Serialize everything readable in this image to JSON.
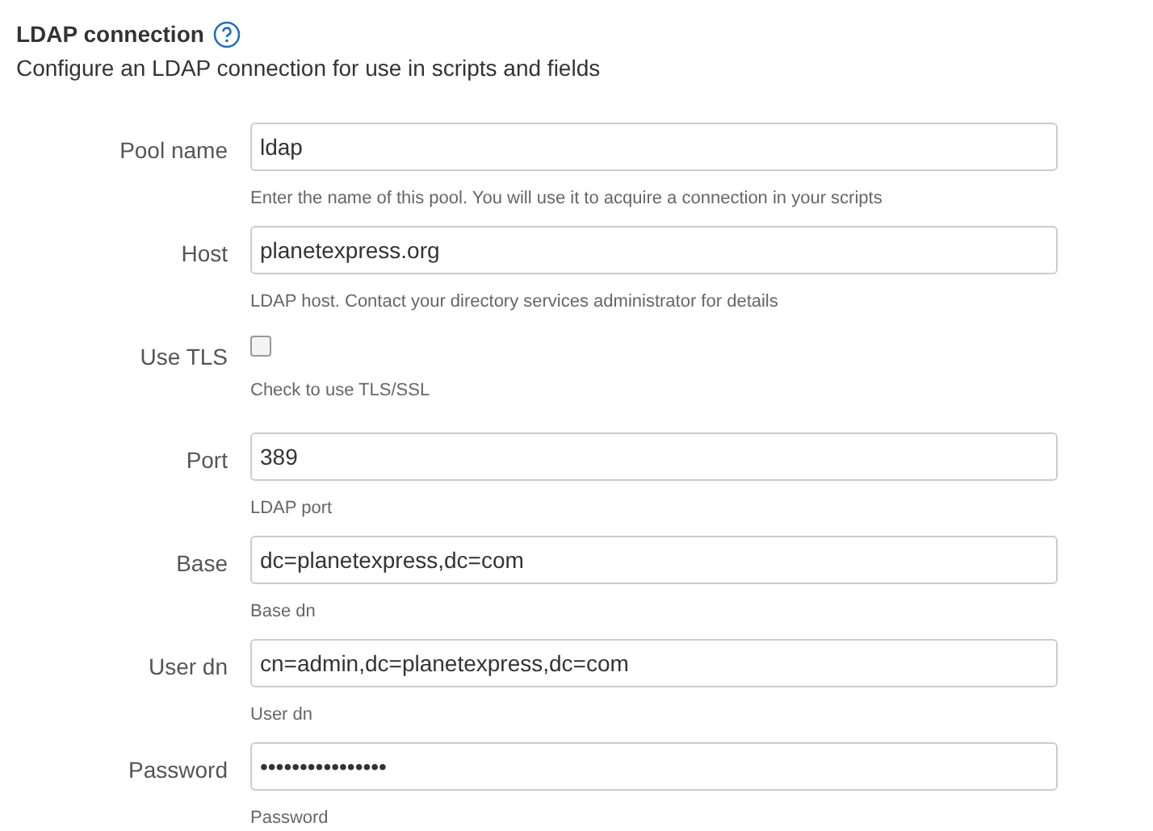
{
  "header": {
    "title": "LDAP connection",
    "subtitle": "Configure an LDAP connection for use in scripts and fields"
  },
  "fields": [
    {
      "kind": "text",
      "label": "Pool name",
      "value": "ldap",
      "help": "Enter the name of this pool. You will use it to acquire a connection in your scripts"
    },
    {
      "kind": "text",
      "label": "Host",
      "value": "planetexpress.org",
      "help": "LDAP host. Contact your directory services administrator for details"
    },
    {
      "kind": "checkbox",
      "label": "Use TLS",
      "checked": false,
      "help": "Check to use TLS/SSL"
    },
    {
      "kind": "text",
      "label": "Port",
      "value": "389",
      "help": "LDAP port"
    },
    {
      "kind": "text",
      "label": "Base",
      "value": "dc=planetexpress,dc=com",
      "help": "Base dn"
    },
    {
      "kind": "text",
      "label": "User dn",
      "value": "cn=admin,dc=planetexpress,dc=com",
      "help": "User dn"
    },
    {
      "kind": "text",
      "label": "Password",
      "value": "••••••••••••••••",
      "help": "Password"
    }
  ]
}
